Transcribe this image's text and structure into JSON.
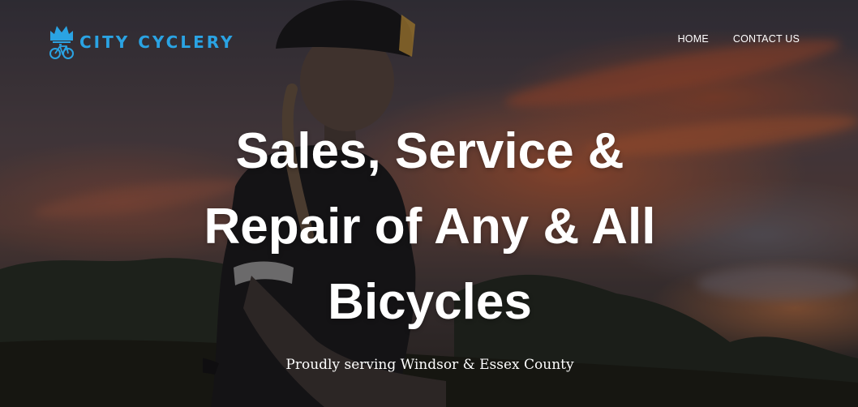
{
  "brand": {
    "name": "CITY CYCLERY",
    "logo_icon": "bike-crown-logo-icon",
    "color": "#2aa3e3"
  },
  "nav": {
    "items": [
      {
        "label": "HOME"
      },
      {
        "label": "CONTACT US"
      }
    ]
  },
  "hero": {
    "headline_lines": [
      "Sales, Service &",
      "Repair of Any & All",
      "Bicycles"
    ],
    "subheadline": "Proudly serving Windsor & Essex County",
    "background": "sunset-cyclist-photo"
  },
  "colors": {
    "text": "#ffffff",
    "accent": "#2aa3e3"
  }
}
